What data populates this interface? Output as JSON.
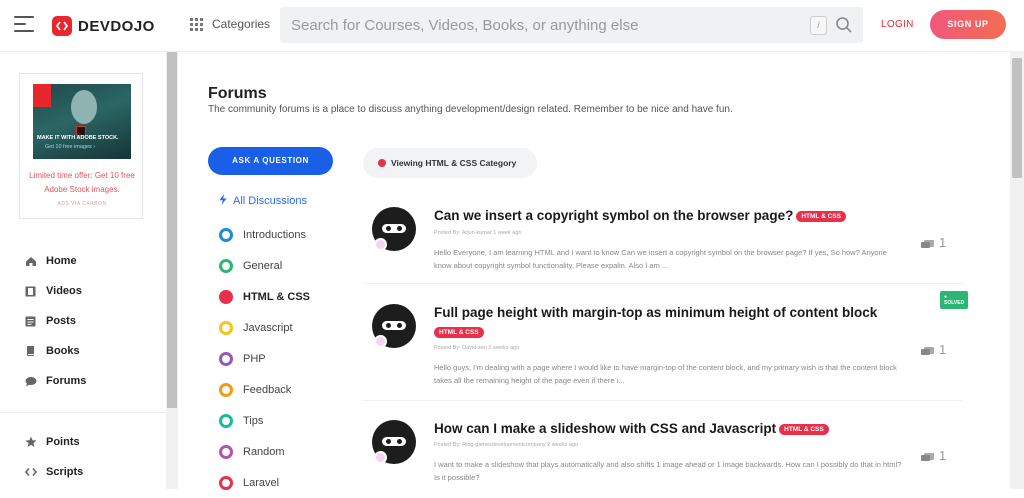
{
  "header": {
    "logo_text": "DEVDOJO",
    "categories_label": "Categories",
    "search_placeholder": "Search for Courses, Videos, Books, or anything else",
    "search_shortcut": "/",
    "login_label": "LOGIN",
    "signup_label": "SIGN UP"
  },
  "ad": {
    "headline": "MAKE IT WITH ADOBE STOCK.",
    "subline": "Get 10 free images ›",
    "offer_text": "Limited time offer: Get 10 free Adobe Stock images.",
    "carbon_label": "ADS VIA CARBON",
    "brand_mark": "Adobe"
  },
  "sidebar": {
    "items": [
      {
        "label": "Home",
        "icon": "home-icon"
      },
      {
        "label": "Videos",
        "icon": "film-icon"
      },
      {
        "label": "Posts",
        "icon": "document-icon"
      },
      {
        "label": "Books",
        "icon": "book-icon"
      },
      {
        "label": "Forums",
        "icon": "chat-icon"
      }
    ],
    "items2": [
      {
        "label": "Points",
        "icon": "star-icon"
      },
      {
        "label": "Scripts",
        "icon": "code-icon"
      }
    ]
  },
  "forums": {
    "title": "Forums",
    "subtitle": "The community forums is a place to discuss anything development/design related. Remember to be nice and have fun.",
    "ask_button": "ASK A QUESTION",
    "viewing_label": "Viewing HTML & CSS Category",
    "all_discussions": "All Discussions",
    "categories": [
      {
        "label": "Introductions",
        "color": "#1a8be8"
      },
      {
        "label": "General",
        "color": "#2bb673"
      },
      {
        "label": "HTML & CSS",
        "color": "#e8304a",
        "active": true
      },
      {
        "label": "Javascript",
        "color": "#f5c518"
      },
      {
        "label": "PHP",
        "color": "#9b59b6"
      },
      {
        "label": "Feedback",
        "color": "#f39c12"
      },
      {
        "label": "Tips",
        "color": "#1abc9c"
      },
      {
        "label": "Random",
        "color": "#b452b4"
      },
      {
        "label": "Laravel",
        "color": "#e8304a"
      }
    ]
  },
  "posts": [
    {
      "title": "Can we insert a copyright symbol on the browser page?",
      "tag": "HTML & CSS",
      "meta": "Posted By: Arjun-kumar 1 week ago",
      "excerpt": "Hello Everyone, I am learning HTML and I want to know Can we insert a copyright symbol on the browser page? If yes, So how? Anyone know about copyright symbol functionality, Please expalin. Also I am ...",
      "count": "1",
      "solved": ""
    },
    {
      "title": "Full page height with margin-top as minimum height of content block",
      "tag": "HTML & CSS",
      "meta": "Posted By: David-sen 2 weeks ago",
      "excerpt": "Hello guys, I'm dealing with a page where I would like to have margin-top of the content block, and my primary wish is that the content block takes all the remaining height of the page even if there i...",
      "count": "1",
      "solved": "● SOLVED"
    },
    {
      "title": "How can I make a slideshow with CSS and Javascript",
      "tag": "HTML & CSS",
      "meta": "Posted By: Ring-gamesdevelopmentcompany 2 weeks ago",
      "excerpt": "I want to make a slideshow that plays automatically and also shifts 1 image ahead or 1 image backwards. How can I possibly do that in html? Is it possible?",
      "count": "1",
      "solved": ""
    }
  ]
}
